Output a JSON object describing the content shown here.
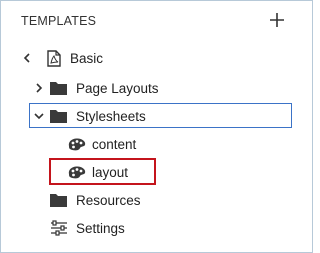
{
  "panel": {
    "title": "TEMPLATES",
    "add_icon": "plus-icon"
  },
  "tree": {
    "root": {
      "label": "Basic",
      "icon": "pdf-file-icon",
      "nav_icon": "chevron-left-icon"
    },
    "items": [
      {
        "label": "Page Layouts",
        "icon": "folder-icon",
        "toggle": "chevron-right-icon",
        "expanded": false
      },
      {
        "label": "Stylesheets",
        "icon": "folder-icon",
        "toggle": "chevron-down-icon",
        "expanded": true,
        "selected": true,
        "children": [
          {
            "label": "content",
            "icon": "palette-icon"
          },
          {
            "label": "layout",
            "icon": "palette-icon",
            "highlighted": true
          }
        ]
      },
      {
        "label": "Resources",
        "icon": "folder-icon"
      },
      {
        "label": "Settings",
        "icon": "sliders-icon"
      }
    ]
  },
  "colors": {
    "selection_border": "#3b73c7",
    "highlight_border": "#c4141c",
    "panel_border": "#b7c9d8"
  }
}
